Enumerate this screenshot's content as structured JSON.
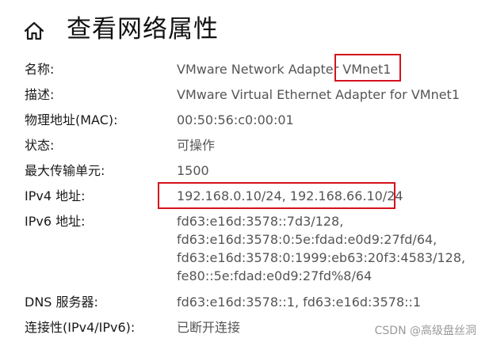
{
  "header": {
    "title": "查看网络属性",
    "home_icon": "home-icon"
  },
  "properties": {
    "name": {
      "label": "名称:",
      "value_prefix": "VMware Network Adapter ",
      "value_highlight": "VMnet1"
    },
    "description": {
      "label": "描述:",
      "value": "VMware Virtual Ethernet Adapter for VMnet1"
    },
    "mac": {
      "label": "物理地址(MAC):",
      "value": "00:50:56:c0:00:01"
    },
    "status": {
      "label": "状态:",
      "value": "可操作"
    },
    "mtu": {
      "label": "最大传输单元:",
      "value": "1500"
    },
    "ipv4": {
      "label": "IPv4 地址:",
      "value": "192.168.0.10/24, 192.168.66.10/24"
    },
    "ipv6": {
      "label": "IPv6 地址:",
      "values": [
        "fd63:e16d:3578::7d3/128,",
        "fd63:e16d:3578:0:5e:fdad:e0d9:27fd/64,",
        "fd63:e16d:3578:0:1999:eb63:20f3:4583/128,",
        "fe80::5e:fdad:e0d9:27fd%8/64"
      ]
    },
    "dns": {
      "label": "DNS 服务器:",
      "value": "fd63:e16d:3578::1, fd63:e16d:3578::1"
    },
    "connectivity": {
      "label": "连接性(IPv4/IPv6):",
      "value": "已断开连接"
    }
  },
  "watermark": "CSDN @高级盘丝洞",
  "colors": {
    "highlight_box": "#d4131b",
    "label_text": "#1a1a1a",
    "value_text": "#555555"
  }
}
